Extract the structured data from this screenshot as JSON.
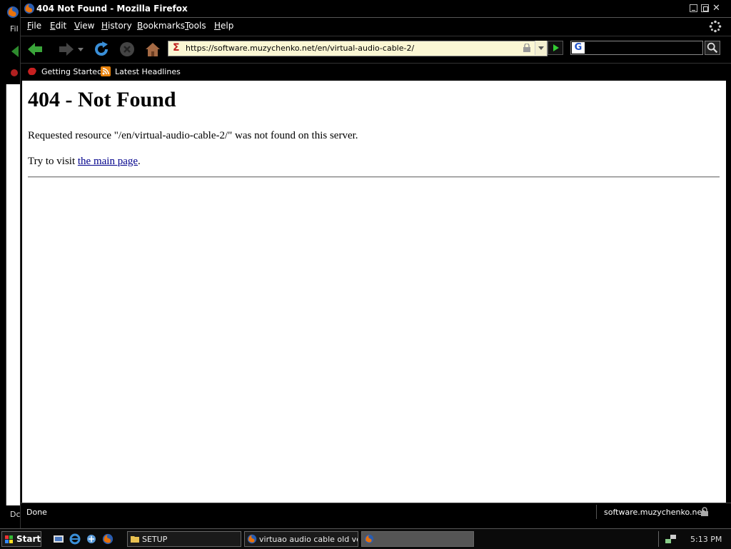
{
  "window": {
    "title": "404 Not Found - Mozilla Firefox"
  },
  "background_window": {
    "menu_fragment": "Fil",
    "status_fragment": "Dc"
  },
  "menu": {
    "items": [
      {
        "label": "File",
        "accel": "F",
        "rest": "ile"
      },
      {
        "label": "Edit",
        "accel": "E",
        "rest": "dit"
      },
      {
        "label": "View",
        "accel": "V",
        "rest": "iew"
      },
      {
        "label": "History",
        "accel": "H",
        "rest": "istory"
      },
      {
        "label": "Bookmarks",
        "accel": "B",
        "rest": "ookmarks"
      },
      {
        "label": "Tools",
        "accel": "T",
        "rest": "ools"
      },
      {
        "label": "Help",
        "accel": "H",
        "rest": "elp"
      }
    ]
  },
  "navigation": {
    "url": "https://software.muzychenko.net/en/virtual-audio-cable-2/",
    "search_engine_icon": "G",
    "search_value": ""
  },
  "bookmarks": {
    "items": [
      "Getting Started",
      "Latest Headlines"
    ]
  },
  "page": {
    "heading": "404 - Not Found",
    "message": "Requested resource \"/en/virtual-audio-cable-2/\" was not found on this server.",
    "visit_prefix": "Try to visit ",
    "visit_link": "the main page",
    "visit_suffix": "."
  },
  "status": {
    "text": "Done",
    "host": "software.muzychenko.net"
  },
  "taskbar": {
    "start_label": "Start",
    "tasks": [
      {
        "label": "SETUP",
        "icon": "folder-icon"
      },
      {
        "label": "virtuao audio cable old ve...",
        "icon": "firefox-icon"
      },
      {
        "label": "",
        "icon": "firefox-icon"
      }
    ],
    "clock": "5:13 PM"
  },
  "colors": {
    "url_background": "#fbf7d4",
    "link": "#00008b",
    "chrome": "#000000"
  }
}
